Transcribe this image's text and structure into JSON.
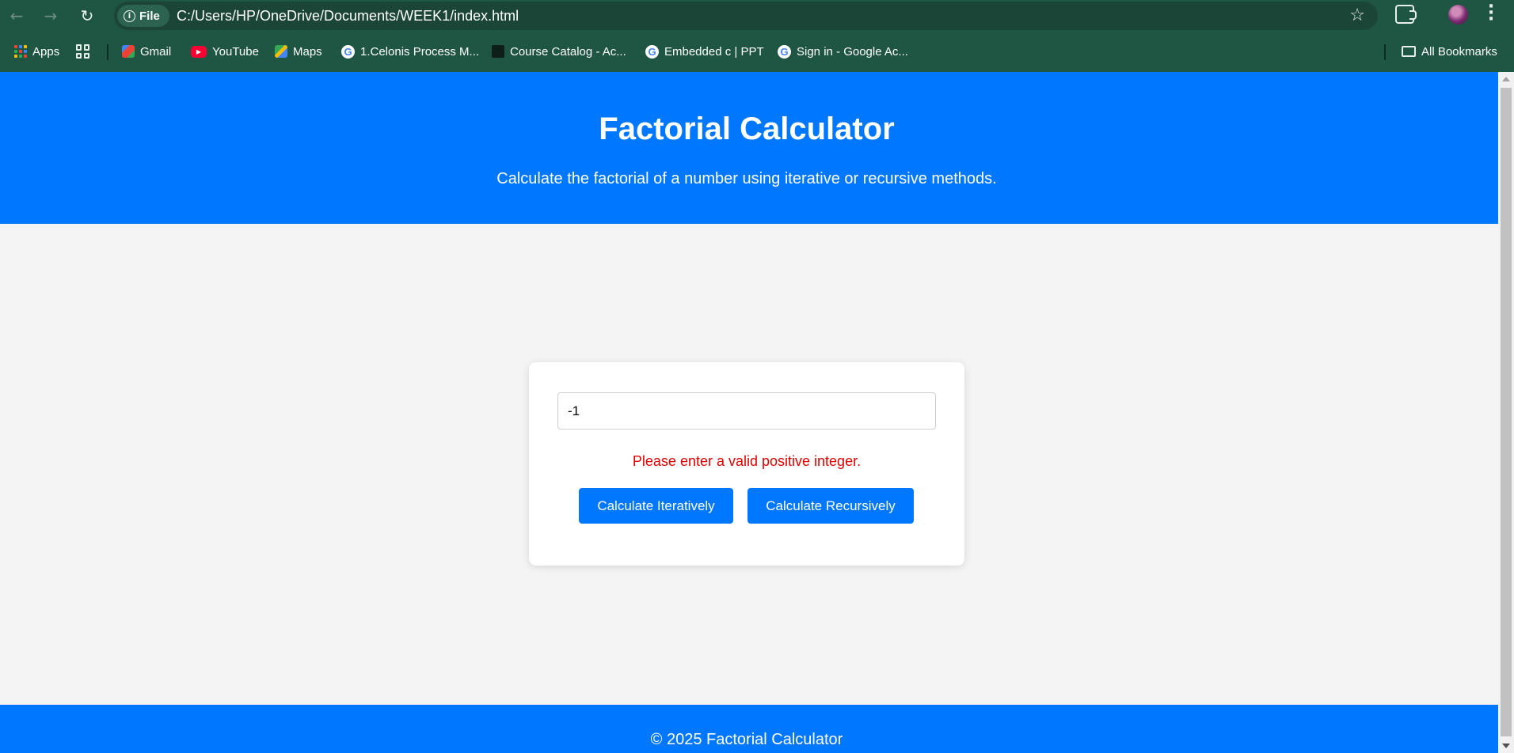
{
  "browser": {
    "site_chip_label": "File",
    "url": "C:/Users/HP/OneDrive/Documents/WEEK1/index.html",
    "bookmarks": [
      {
        "label": "Apps",
        "icon": "apps-grid-icon"
      },
      {
        "label": "Gmail",
        "icon": "gmail-icon"
      },
      {
        "label": "YouTube",
        "icon": "youtube-icon"
      },
      {
        "label": "Maps",
        "icon": "maps-icon"
      },
      {
        "label": "1.Celonis Process M...",
        "icon": "google-icon"
      },
      {
        "label": "Course Catalog - Ac...",
        "icon": "graduation-cap-icon"
      },
      {
        "label": "Embedded c | PPT",
        "icon": "google-icon"
      },
      {
        "label": "Sign in - Google Ac...",
        "icon": "google-icon"
      }
    ],
    "all_bookmarks_label": "All Bookmarks",
    "google_glyph": "G"
  },
  "header": {
    "title": "Factorial Calculator",
    "subtitle": "Calculate the factorial of a number using iterative or recursive methods."
  },
  "calculator": {
    "input_value": "-1",
    "error_message": "Please enter a valid positive integer.",
    "iterative_button_label": "Calculate Iteratively",
    "recursive_button_label": "Calculate Recursively"
  },
  "footer": {
    "text": "© 2025 Factorial Calculator"
  },
  "colors": {
    "chrome_bg": "#1f5543",
    "accent_blue": "#0077ff",
    "error_red": "#e00000",
    "page_bg": "#f4f4f4"
  }
}
